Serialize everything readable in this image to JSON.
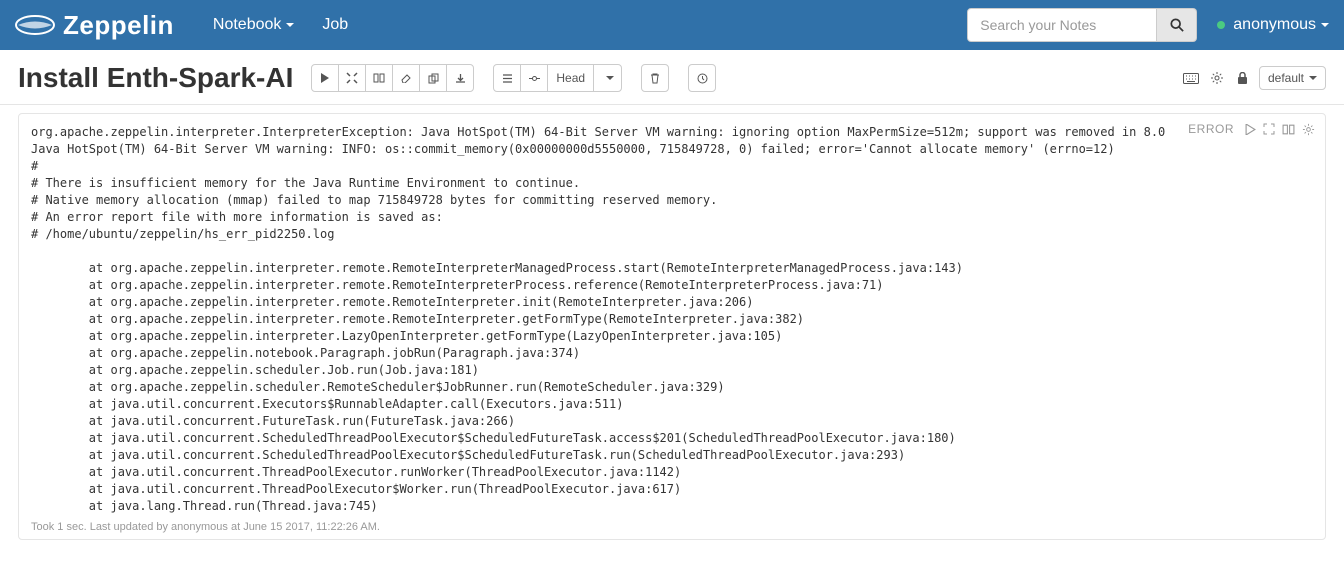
{
  "nav": {
    "brand": "Zeppelin",
    "notebook": "Notebook",
    "job": "Job",
    "search_placeholder": "Search your Notes",
    "user": "anonymous"
  },
  "note": {
    "title": "Install Enth-Spark-AI",
    "head_label": "Head",
    "default_label": "default"
  },
  "paragraph": {
    "status": "ERROR",
    "output": "org.apache.zeppelin.interpreter.InterpreterException: Java HotSpot(TM) 64-Bit Server VM warning: ignoring option MaxPermSize=512m; support was removed in 8.0\nJava HotSpot(TM) 64-Bit Server VM warning: INFO: os::commit_memory(0x00000000d5550000, 715849728, 0) failed; error='Cannot allocate memory' (errno=12)\n#\n# There is insufficient memory for the Java Runtime Environment to continue.\n# Native memory allocation (mmap) failed to map 715849728 bytes for committing reserved memory.\n# An error report file with more information is saved as:\n# /home/ubuntu/zeppelin/hs_err_pid2250.log\n\n        at org.apache.zeppelin.interpreter.remote.RemoteInterpreterManagedProcess.start(RemoteInterpreterManagedProcess.java:143)\n        at org.apache.zeppelin.interpreter.remote.RemoteInterpreterProcess.reference(RemoteInterpreterProcess.java:71)\n        at org.apache.zeppelin.interpreter.remote.RemoteInterpreter.init(RemoteInterpreter.java:206)\n        at org.apache.zeppelin.interpreter.remote.RemoteInterpreter.getFormType(RemoteInterpreter.java:382)\n        at org.apache.zeppelin.interpreter.LazyOpenInterpreter.getFormType(LazyOpenInterpreter.java:105)\n        at org.apache.zeppelin.notebook.Paragraph.jobRun(Paragraph.java:374)\n        at org.apache.zeppelin.scheduler.Job.run(Job.java:181)\n        at org.apache.zeppelin.scheduler.RemoteScheduler$JobRunner.run(RemoteScheduler.java:329)\n        at java.util.concurrent.Executors$RunnableAdapter.call(Executors.java:511)\n        at java.util.concurrent.FutureTask.run(FutureTask.java:266)\n        at java.util.concurrent.ScheduledThreadPoolExecutor$ScheduledFutureTask.access$201(ScheduledThreadPoolExecutor.java:180)\n        at java.util.concurrent.ScheduledThreadPoolExecutor$ScheduledFutureTask.run(ScheduledThreadPoolExecutor.java:293)\n        at java.util.concurrent.ThreadPoolExecutor.runWorker(ThreadPoolExecutor.java:1142)\n        at java.util.concurrent.ThreadPoolExecutor$Worker.run(ThreadPoolExecutor.java:617)\n        at java.lang.Thread.run(Thread.java:745)",
    "footer": "Took 1 sec. Last updated by anonymous at June 15 2017, 11:22:26 AM."
  }
}
